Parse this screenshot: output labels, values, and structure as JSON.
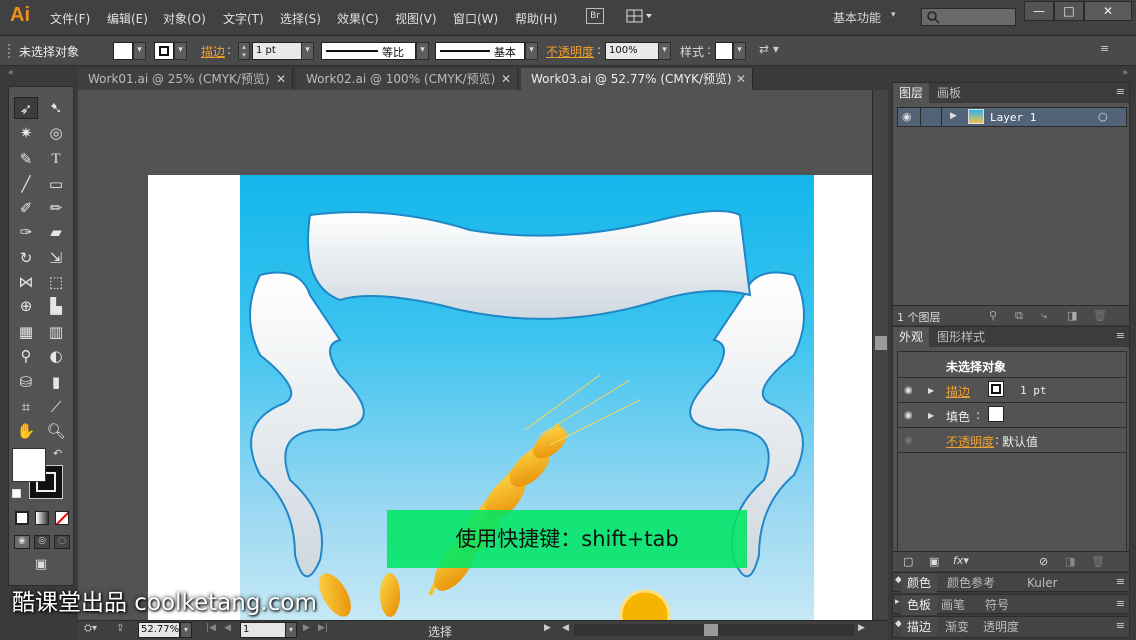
{
  "app": {
    "logo": "Ai"
  },
  "menu": [
    "文件(F)",
    "编辑(E)",
    "对象(O)",
    "文字(T)",
    "选择(S)",
    "效果(C)",
    "视图(V)",
    "窗口(W)",
    "帮助(H)"
  ],
  "bridge_label": "Br",
  "workspace": "基本功能",
  "win_controls": {
    "minimize": "—",
    "maximize": "□",
    "close": "✕"
  },
  "control": {
    "selection": "未选择对象",
    "stroke_label": "描边",
    "stroke_weight": "1 pt",
    "profile": "等比",
    "brush": "基本",
    "opacity_label": "不透明度",
    "opacity_value": "100%",
    "style_label": "样式"
  },
  "tabs": [
    {
      "label": "Work01.ai @ 25% (CMYK/预览)",
      "active": false
    },
    {
      "label": "Work02.ai @ 100% (CMYK/预览)",
      "active": false
    },
    {
      "label": "Work03.ai @ 52.77% (CMYK/预览)",
      "active": true
    }
  ],
  "layers": {
    "tabs": [
      "图层",
      "画板"
    ],
    "items": [
      {
        "name": "Layer 1"
      }
    ],
    "count": "1 个图层"
  },
  "appearance": {
    "tabs": [
      "外观",
      "图形样式"
    ],
    "title": "未选择对象",
    "stroke_label": "描边",
    "stroke_value": "1 pt",
    "fill_label": "填色",
    "opacity_label": "不透明度",
    "opacity_value": "默认值"
  },
  "color_panel_tabs": [
    "颜色",
    "颜色参考",
    "Kuler"
  ],
  "swatch_tabs": [
    "色板",
    "画笔",
    "符号"
  ],
  "stroke_panel_tabs": [
    "描边",
    "渐变",
    "透明度"
  ],
  "status": {
    "zoom": "52.77%",
    "page": "1",
    "tool": "选择"
  },
  "overlay_text": "使用快捷键：shift+tab",
  "watermark": "酷课堂出品 coolketang.com",
  "colors": {
    "accent_orange": "#f0a030",
    "layer_highlight": "#536377",
    "banner_green": "#00e664"
  }
}
